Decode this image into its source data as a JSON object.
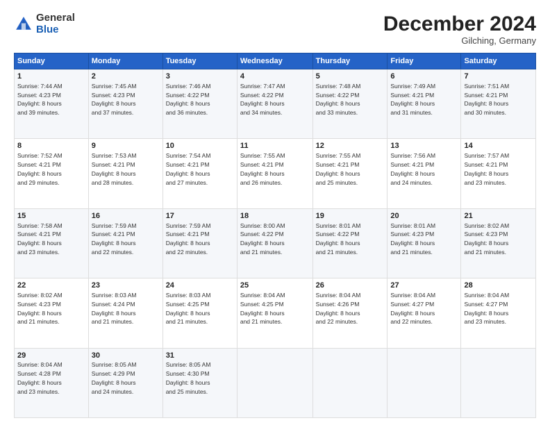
{
  "logo": {
    "general": "General",
    "blue": "Blue"
  },
  "header": {
    "month": "December 2024",
    "location": "Gilching, Germany"
  },
  "weekdays": [
    "Sunday",
    "Monday",
    "Tuesday",
    "Wednesday",
    "Thursday",
    "Friday",
    "Saturday"
  ],
  "weeks": [
    [
      {
        "day": 1,
        "sunrise": "7:44 AM",
        "sunset": "4:23 PM",
        "daylight": "8 hours and 39 minutes."
      },
      {
        "day": 2,
        "sunrise": "7:45 AM",
        "sunset": "4:23 PM",
        "daylight": "8 hours and 37 minutes."
      },
      {
        "day": 3,
        "sunrise": "7:46 AM",
        "sunset": "4:22 PM",
        "daylight": "8 hours and 36 minutes."
      },
      {
        "day": 4,
        "sunrise": "7:47 AM",
        "sunset": "4:22 PM",
        "daylight": "8 hours and 34 minutes."
      },
      {
        "day": 5,
        "sunrise": "7:48 AM",
        "sunset": "4:22 PM",
        "daylight": "8 hours and 33 minutes."
      },
      {
        "day": 6,
        "sunrise": "7:49 AM",
        "sunset": "4:21 PM",
        "daylight": "8 hours and 31 minutes."
      },
      {
        "day": 7,
        "sunrise": "7:51 AM",
        "sunset": "4:21 PM",
        "daylight": "8 hours and 30 minutes."
      }
    ],
    [
      {
        "day": 8,
        "sunrise": "7:52 AM",
        "sunset": "4:21 PM",
        "daylight": "8 hours and 29 minutes."
      },
      {
        "day": 9,
        "sunrise": "7:53 AM",
        "sunset": "4:21 PM",
        "daylight": "8 hours and 28 minutes."
      },
      {
        "day": 10,
        "sunrise": "7:54 AM",
        "sunset": "4:21 PM",
        "daylight": "8 hours and 27 minutes."
      },
      {
        "day": 11,
        "sunrise": "7:55 AM",
        "sunset": "4:21 PM",
        "daylight": "8 hours and 26 minutes."
      },
      {
        "day": 12,
        "sunrise": "7:55 AM",
        "sunset": "4:21 PM",
        "daylight": "8 hours and 25 minutes."
      },
      {
        "day": 13,
        "sunrise": "7:56 AM",
        "sunset": "4:21 PM",
        "daylight": "8 hours and 24 minutes."
      },
      {
        "day": 14,
        "sunrise": "7:57 AM",
        "sunset": "4:21 PM",
        "daylight": "8 hours and 23 minutes."
      }
    ],
    [
      {
        "day": 15,
        "sunrise": "7:58 AM",
        "sunset": "4:21 PM",
        "daylight": "8 hours and 23 minutes."
      },
      {
        "day": 16,
        "sunrise": "7:59 AM",
        "sunset": "4:21 PM",
        "daylight": "8 hours and 22 minutes."
      },
      {
        "day": 17,
        "sunrise": "7:59 AM",
        "sunset": "4:21 PM",
        "daylight": "8 hours and 22 minutes."
      },
      {
        "day": 18,
        "sunrise": "8:00 AM",
        "sunset": "4:22 PM",
        "daylight": "8 hours and 21 minutes."
      },
      {
        "day": 19,
        "sunrise": "8:01 AM",
        "sunset": "4:22 PM",
        "daylight": "8 hours and 21 minutes."
      },
      {
        "day": 20,
        "sunrise": "8:01 AM",
        "sunset": "4:23 PM",
        "daylight": "8 hours and 21 minutes."
      },
      {
        "day": 21,
        "sunrise": "8:02 AM",
        "sunset": "4:23 PM",
        "daylight": "8 hours and 21 minutes."
      }
    ],
    [
      {
        "day": 22,
        "sunrise": "8:02 AM",
        "sunset": "4:23 PM",
        "daylight": "8 hours and 21 minutes."
      },
      {
        "day": 23,
        "sunrise": "8:03 AM",
        "sunset": "4:24 PM",
        "daylight": "8 hours and 21 minutes."
      },
      {
        "day": 24,
        "sunrise": "8:03 AM",
        "sunset": "4:25 PM",
        "daylight": "8 hours and 21 minutes."
      },
      {
        "day": 25,
        "sunrise": "8:04 AM",
        "sunset": "4:25 PM",
        "daylight": "8 hours and 21 minutes."
      },
      {
        "day": 26,
        "sunrise": "8:04 AM",
        "sunset": "4:26 PM",
        "daylight": "8 hours and 22 minutes."
      },
      {
        "day": 27,
        "sunrise": "8:04 AM",
        "sunset": "4:27 PM",
        "daylight": "8 hours and 22 minutes."
      },
      {
        "day": 28,
        "sunrise": "8:04 AM",
        "sunset": "4:27 PM",
        "daylight": "8 hours and 23 minutes."
      }
    ],
    [
      {
        "day": 29,
        "sunrise": "8:04 AM",
        "sunset": "4:28 PM",
        "daylight": "8 hours and 23 minutes."
      },
      {
        "day": 30,
        "sunrise": "8:05 AM",
        "sunset": "4:29 PM",
        "daylight": "8 hours and 24 minutes."
      },
      {
        "day": 31,
        "sunrise": "8:05 AM",
        "sunset": "4:30 PM",
        "daylight": "8 hours and 25 minutes."
      },
      null,
      null,
      null,
      null
    ]
  ]
}
